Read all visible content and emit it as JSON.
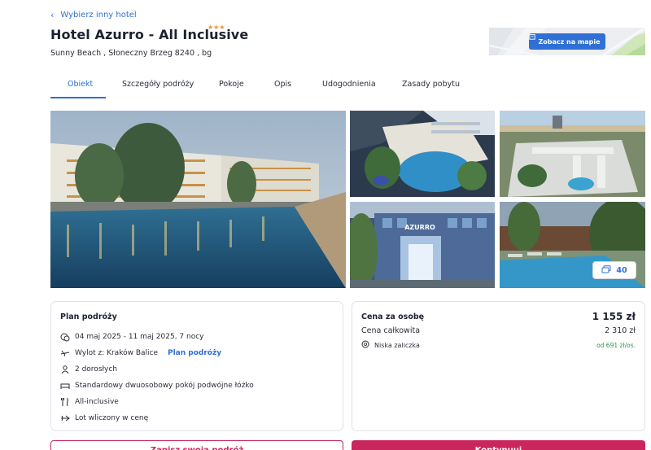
{
  "nav": {
    "back_label": "Wybierz inny hotel"
  },
  "hotel": {
    "name": "Hotel Azurro - All Inclusive",
    "stars": "★★★",
    "address": "Sunny Beach , Słoneczny Brzeg 8240 , bg"
  },
  "map": {
    "button_label": "Zobacz na mapie"
  },
  "tabs": [
    {
      "label": "Obiekt",
      "active": true
    },
    {
      "label": "Szczegóły podróży"
    },
    {
      "label": "Pokoje"
    },
    {
      "label": "Opis"
    },
    {
      "label": "Udogodnienia"
    },
    {
      "label": "Zasady pobytu"
    }
  ],
  "gallery": {
    "photo_count": "40",
    "sign_text": "AZURRO"
  },
  "plan": {
    "heading": "Plan podróży",
    "dates": "04 maj 2025 - 11 maj 2025, 7 nocy",
    "departure": "Wylot z: Kraków Balice",
    "departure_link": "Plan podróży",
    "guests": "2 dorosłych",
    "room": "Standardowy dwuosobowy pokój podwójne łóżko",
    "board": "All-inclusive",
    "extras": "Lot wliczony w cenę"
  },
  "price": {
    "per_person_label": "Cena za osobę",
    "per_person_value": "1 155 zł",
    "total_label": "Cena całkowita",
    "total_value": "2 310 zł",
    "deposit_label": "Niska zaliczka",
    "deposit_value": "od 691 zł/os."
  },
  "actions": {
    "save_label": "Zapisz swoją podróż",
    "continue_label": "Kontynuuj"
  },
  "colors": {
    "accent": "#2f6fd6",
    "brand": "#c9265d",
    "stars": "#f0913a",
    "deposit": "#2f9a4c"
  }
}
